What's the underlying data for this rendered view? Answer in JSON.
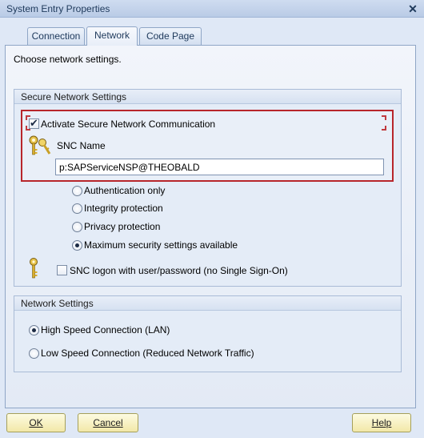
{
  "window": {
    "title": "System Entry Properties",
    "close_glyph": "✕"
  },
  "tabs": [
    {
      "label": "Connection"
    },
    {
      "label": "Network"
    },
    {
      "label": "Code Page"
    }
  ],
  "intro": "Choose network settings.",
  "secure": {
    "header": "Secure Network Settings",
    "activate_label": "Activate Secure Network Communication",
    "activate_checked": true,
    "snc_name_label": "SNC Name",
    "snc_name_value": "p:SAPServiceNSP@THEOBALD",
    "options": [
      {
        "label": "Authentication only",
        "checked": false
      },
      {
        "label": "Integrity protection",
        "checked": false
      },
      {
        "label": "Privacy protection",
        "checked": false
      },
      {
        "label": "Maximum security settings available",
        "checked": true
      }
    ],
    "logon_label": "SNC logon with user/password (no Single Sign-On)",
    "logon_checked": false
  },
  "network": {
    "header": "Network Settings",
    "options": [
      {
        "label": "High Speed Connection (LAN)",
        "checked": true
      },
      {
        "label": "Low Speed Connection (Reduced Network Traffic)",
        "checked": false
      }
    ]
  },
  "buttons": {
    "ok": "OK",
    "cancel": "Cancel",
    "help": "Help"
  },
  "icons": {
    "keys": "keys-icon",
    "key": "key-icon"
  },
  "colors": {
    "highlight_border": "#b8262b",
    "background": "#dfe8f6"
  }
}
